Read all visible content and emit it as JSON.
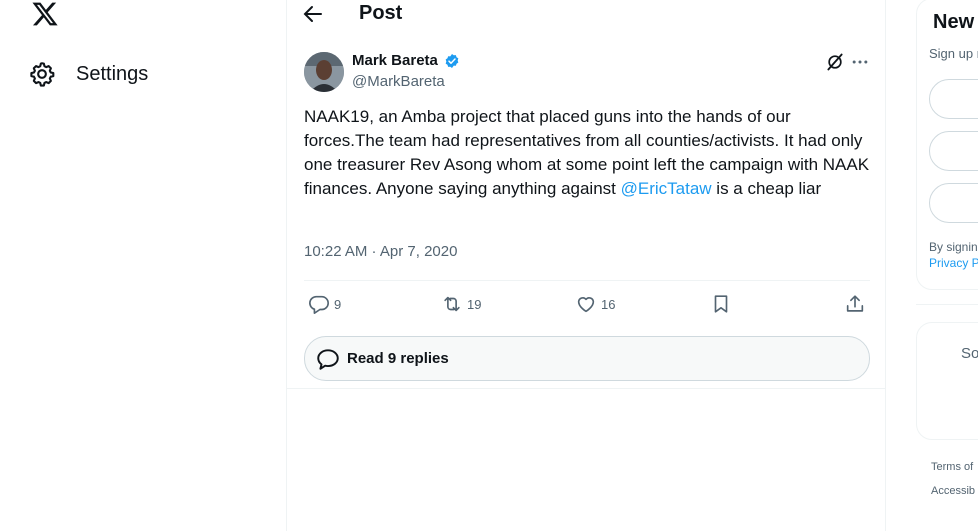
{
  "left_nav": {
    "logo_icon": "x-logo-icon",
    "settings_label": "Settings",
    "settings_icon": "gear-icon"
  },
  "header": {
    "title": "Post",
    "back_icon": "arrow-left-icon"
  },
  "tweet": {
    "author_name": "Mark Bareta",
    "author_handle": "@MarkBareta",
    "verified": true,
    "text_before_mention": "NAAK19, an Amba project that placed guns into the hands of our forces.The team had representatives from all counties/activists. It had only one treasurer Rev Asong whom at some point left the campaign with NAAK finances. Anyone saying anything against ",
    "mention": "@EricTataw",
    "text_after_mention": " is a cheap liar",
    "timestamp": "10:22 AM · Apr 7, 2020",
    "stats": {
      "replies": "9",
      "reposts": "19",
      "likes": "16"
    },
    "read_replies_label": "Read 9 replies"
  },
  "right_sidebar": {
    "signup_title": "New",
    "signup_subtitle": "Sign up n",
    "terms_line1": "By signin",
    "terms_line2": "Privacy P",
    "trend_text": "So",
    "footer_terms": "Terms of",
    "footer_access": "Accessib"
  },
  "colors": {
    "accent": "#1d9bf0",
    "text": "#0f1419",
    "secondary": "#536471",
    "border": "#eff3f4"
  }
}
